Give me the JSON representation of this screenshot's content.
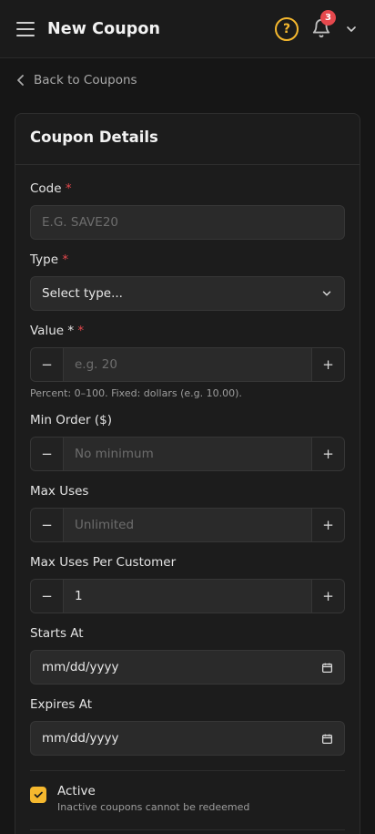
{
  "header": {
    "title": "New Coupon",
    "help_label": "?",
    "notification_count": "3"
  },
  "back_link": {
    "label": "Back to Coupons"
  },
  "card": {
    "title": "Coupon Details",
    "fields": {
      "code": {
        "label": "Code",
        "required_mark": "*",
        "placeholder": "E.G. SAVE20",
        "value": ""
      },
      "type": {
        "label": "Type",
        "required_mark": "*",
        "selected": "Select type..."
      },
      "value": {
        "label": "Value *",
        "required_mark": "*",
        "placeholder": "e.g. 20",
        "value": "",
        "hint": "Percent: 0–100. Fixed: dollars (e.g. 10.00)."
      },
      "min_order": {
        "label": "Min Order ($)",
        "placeholder": "No minimum",
        "value": ""
      },
      "max_uses": {
        "label": "Max Uses",
        "placeholder": "Unlimited",
        "value": ""
      },
      "max_uses_per_customer": {
        "label": "Max Uses Per Customer",
        "value": "1"
      },
      "starts_at": {
        "label": "Starts At",
        "value": "mm/dd/yyyy"
      },
      "expires_at": {
        "label": "Expires At",
        "value": "mm/dd/yyyy"
      }
    },
    "stepper": {
      "minus_label": "−",
      "plus_label": "+"
    },
    "active": {
      "label": "Active",
      "description": "Inactive coupons cannot be redeemed",
      "checked": true
    }
  },
  "colors": {
    "accent": "#f5b82e",
    "danger": "#e5484d",
    "background": "#161616",
    "surface": "#1c1c1c",
    "input": "#2a2a2a"
  }
}
